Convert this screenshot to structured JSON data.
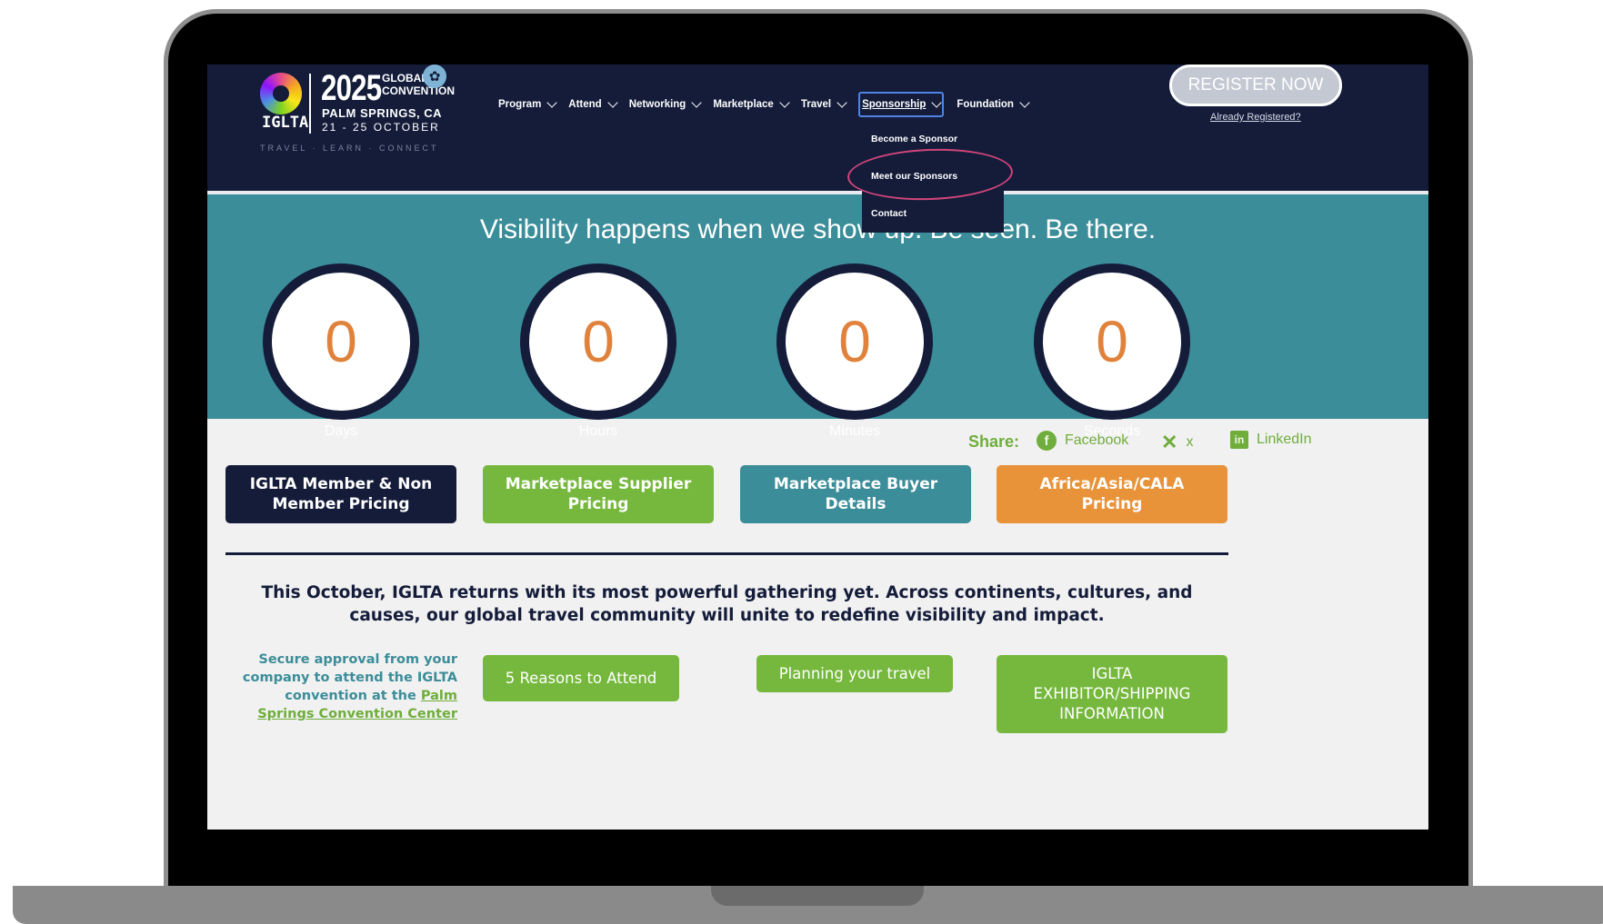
{
  "header": {
    "logo": {
      "year": "2025",
      "global": "GLOBAL",
      "convention": "CONVENTION",
      "org": "IGLTA",
      "city": "PALM SPRINGS, CA",
      "dates": "21 - 25 OCTOBER",
      "tagline": "TRAVEL · LEARN · CONNECT",
      "palm_icon": "palm-tree-icon"
    },
    "nav": [
      {
        "label": "Program"
      },
      {
        "label": "Attend"
      },
      {
        "label": "Networking"
      },
      {
        "label": "Marketplace"
      },
      {
        "label": "Travel"
      },
      {
        "label": "Sponsorship"
      },
      {
        "label": "Foundation"
      }
    ],
    "register_label": "REGISTER NOW",
    "already_registered": "Already Registered?",
    "dropdown": [
      {
        "label": "Become a Sponsor"
      },
      {
        "label": "Meet our Sponsors"
      },
      {
        "label": "Contact"
      }
    ]
  },
  "countdown": {
    "headline": "Visibility happens when we show up. Be seen. Be there.",
    "units": [
      {
        "value": "0",
        "label": "Days"
      },
      {
        "value": "0",
        "label": "Hours"
      },
      {
        "value": "0",
        "label": "Minutes"
      },
      {
        "value": "0",
        "label": "Seconds"
      }
    ]
  },
  "share": {
    "label": "Share:",
    "links": [
      {
        "label": "Facebook",
        "icon": "facebook-icon"
      },
      {
        "label": "x",
        "icon": "x-icon"
      },
      {
        "label": "LinkedIn",
        "icon": "linkedin-icon"
      }
    ]
  },
  "pricing_buttons": [
    {
      "label": "IGLTA Member & Non Member Pricing",
      "color": "#141c3a"
    },
    {
      "label": "Marketplace Supplier Pricing",
      "color": "#76b83d"
    },
    {
      "label": "Marketplace Buyer Details",
      "color": "#3b8d99"
    },
    {
      "label": "Africa/Asia/CALA Pricing",
      "color": "#e8933a"
    }
  ],
  "intro_text": "This October, IGLTA returns with its most powerful gathering yet. Across continents, cultures, and causes, our global travel community will unite to redefine visibility and impact.",
  "approval": {
    "text": "Secure approval from your company to attend the IGLTA convention at the",
    "link": "Palm Springs Convention Center"
  },
  "action_buttons": [
    {
      "label": "5 Reasons to Attend"
    },
    {
      "label": "Planning your travel"
    },
    {
      "label": "IGLTA EXHIBITOR/SHIPPING INFORMATION"
    }
  ],
  "colors": {
    "navy": "#141c3a",
    "teal": "#3b8d99",
    "green": "#76b83d",
    "orange": "#e8933a",
    "highlight_circle": "#d1457a"
  }
}
